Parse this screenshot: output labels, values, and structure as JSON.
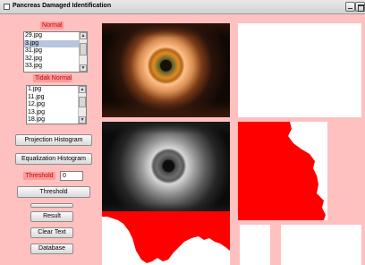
{
  "window": {
    "title": "Pancreas Damaged Identification"
  },
  "normal": {
    "label": "Normal",
    "items": [
      "29.jpg",
      "3.jpg",
      "31.jpg",
      "32.jpg",
      "33.jpg"
    ],
    "selected_index": 1
  },
  "tidak_normal": {
    "label": "Tidak Normal",
    "items": [
      "1.jpg",
      "11.jpg",
      "12.jpg",
      "13.jpg",
      "18.jpg"
    ]
  },
  "buttons": {
    "projection_histogram": "Projection Histogram",
    "equalization_histogram": "Equalization Histogram",
    "threshold": "Threshold",
    "result": "Result",
    "clear_text": "Clear Text",
    "database": "Database"
  },
  "threshold": {
    "label": "Threshold",
    "value": "0"
  },
  "colors": {
    "background": "#ffc0c0",
    "label_bg": "#ff9a9a",
    "label_text": "#b01010",
    "histogram_fill": "#ff0000"
  }
}
